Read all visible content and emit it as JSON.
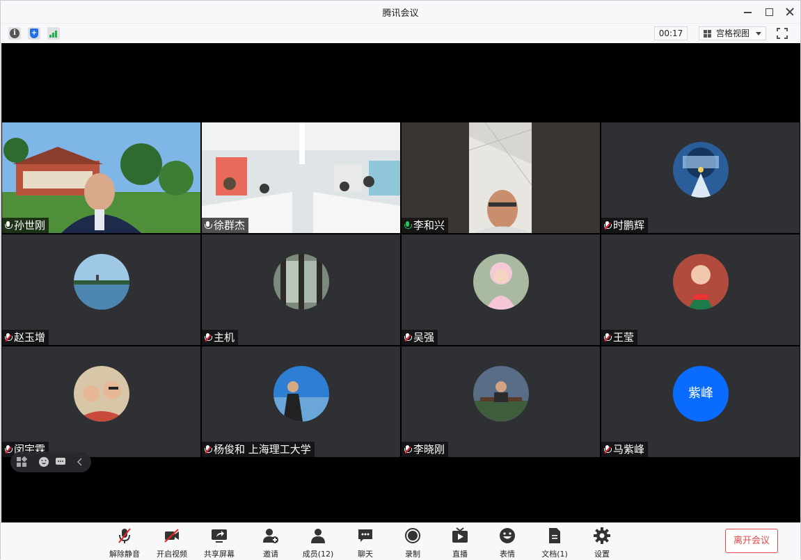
{
  "window": {
    "title": "腾讯会议"
  },
  "infobar": {
    "timer": "00:17",
    "view_mode": "宫格视图",
    "info_glyph": "i",
    "shield_glyph": "+"
  },
  "participants": [
    {
      "name": "孙世刚",
      "mic": "on",
      "kind": "video",
      "scene": "campus"
    },
    {
      "name": "徐群杰",
      "mic": "on",
      "kind": "video",
      "scene": "meeting-room"
    },
    {
      "name": "李和兴",
      "mic": "speaking",
      "kind": "video",
      "scene": "ceiling"
    },
    {
      "name": "时鹏辉",
      "mic": "muted",
      "kind": "avatar",
      "scene": "soul-poster"
    },
    {
      "name": "赵玉增",
      "mic": "muted",
      "kind": "avatar",
      "scene": "lake"
    },
    {
      "name": "主机",
      "mic": "muted",
      "kind": "avatar",
      "scene": "window"
    },
    {
      "name": "吴强",
      "mic": "muted",
      "kind": "avatar",
      "scene": "child-pink"
    },
    {
      "name": "王莹",
      "mic": "muted",
      "kind": "avatar",
      "scene": "child-red"
    },
    {
      "name": "闵宇霖",
      "mic": "muted",
      "kind": "avatar",
      "scene": "kids"
    },
    {
      "name": "杨俊和  上海理工大学",
      "mic": "muted",
      "kind": "avatar",
      "scene": "person-sea"
    },
    {
      "name": "李晓刚",
      "mic": "muted",
      "kind": "avatar",
      "scene": "bench"
    },
    {
      "name": "马紫峰",
      "mic": "muted",
      "kind": "initials",
      "initials": "紫峰",
      "color": "#0a6cff"
    }
  ],
  "toolbar": {
    "unmute": "解除静音",
    "start_video": "开启视频",
    "share_screen": "共享屏幕",
    "invite": "邀请",
    "members": "成员(12)",
    "chat": "聊天",
    "record": "录制",
    "live": "直播",
    "reactions": "表情",
    "docs": "文档(1)",
    "settings": "设置",
    "leave": "离开会议"
  },
  "colors": {
    "accent": "#0a6cff",
    "speaking": "#1ec36b",
    "muted": "#e22233",
    "leave": "#e54848"
  }
}
